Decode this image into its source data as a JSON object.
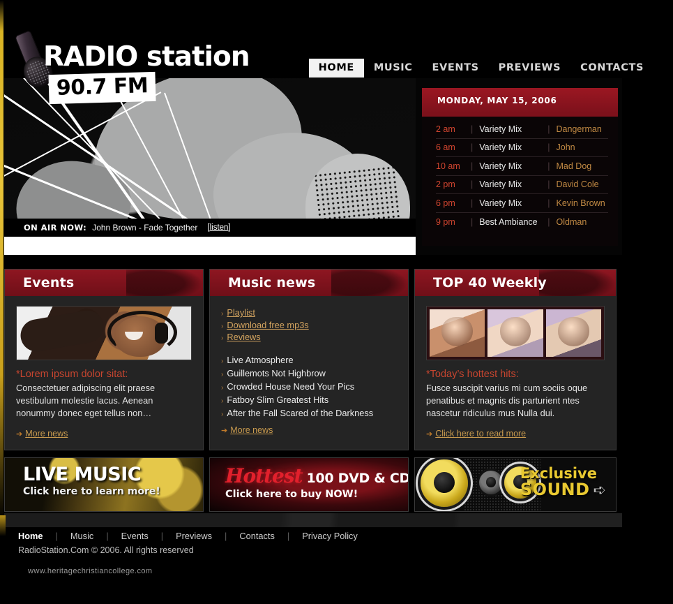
{
  "brand": {
    "name_bold": "RADIO",
    "name_light": "station",
    "frequency": "90.7 FM",
    "mic_icon": "microphone-icon"
  },
  "nav": {
    "items": [
      {
        "label": "HOME",
        "active": true
      },
      {
        "label": "MUSIC",
        "active": false
      },
      {
        "label": "EVENTS",
        "active": false
      },
      {
        "label": "PREVIEWS",
        "active": false
      },
      {
        "label": "CONTACTS",
        "active": false
      }
    ]
  },
  "onair": {
    "label": "ON AIR NOW:",
    "track": "John Brown - Fade Together",
    "listen": "[listen]"
  },
  "schedule": {
    "date": "MONDAY, MAY 15, 2006",
    "rows": [
      {
        "time": "2 am",
        "show": "Variety Mix",
        "host": "Dangerman"
      },
      {
        "time": "6 am",
        "show": "Variety Mix",
        "host": "John"
      },
      {
        "time": "10 am",
        "show": "Variety Mix",
        "host": "Mad Dog"
      },
      {
        "time": "2 pm",
        "show": "Variety Mix",
        "host": "David Cole"
      },
      {
        "time": "6 pm",
        "show": "Variety Mix",
        "host": "Kevin Brown"
      },
      {
        "time": "9 pm",
        "show": "Best Ambiance",
        "host": "Oldman"
      }
    ]
  },
  "columns": {
    "events": {
      "title": "Events",
      "photo_alt": "woman-with-headphones-photo",
      "lead": "*Lorem ipsum dolor sitat:",
      "body": "Consectetuer adipiscing elit praese vestibulum molestie lacus. Aenean nonummy donec eget tellus non…",
      "more_label": "More news"
    },
    "music_news": {
      "title": "Music news",
      "links": [
        "Playlist",
        "Download free mp3s",
        "Reviews"
      ],
      "items": [
        "Live Atmosphere",
        "Guillemots Not Highbrow",
        "Crowded House Need Your Pics",
        "Fatboy Slim Greatest Hits",
        "After the Fall Scared of the Darkness"
      ],
      "more_label": "More news"
    },
    "top40": {
      "title": "TOP 40 Weekly",
      "photo_alt": "three-artist-portraits-photo",
      "lead": "*Today’s hottest hits:",
      "body": "Fusce suscipit varius mi cum sociis oque penatibus et magnis dis parturient ntes nascetur ridiculus mus Nulla dui.",
      "more_label": "Click here to read more"
    }
  },
  "banners": [
    {
      "title": "LIVE MUSIC",
      "subtitle": "Click here to learn more!"
    },
    {
      "title_script": "Hottest",
      "title_rest": "100 DVD & CD",
      "subtitle": "Click here to buy NOW!"
    },
    {
      "line1": "Exclusive",
      "line2": "SOUND",
      "arrow": "arrow-right-icon"
    }
  ],
  "footer": {
    "links": [
      "Home",
      "Music",
      "Events",
      "Previews",
      "Contacts",
      "Privacy Policy"
    ],
    "separator": "|",
    "copyright": "RadioStation.Com © 2006. All rights reserved",
    "watermark": "www.heritagechristiancollege.com"
  },
  "colors": {
    "accent_red": "#8e1621",
    "gold": "#e8c43a",
    "link_gold": "#c89a4e",
    "lead_red": "#c6452f",
    "panel_bg": "#242424",
    "page_bg": "#000000"
  }
}
